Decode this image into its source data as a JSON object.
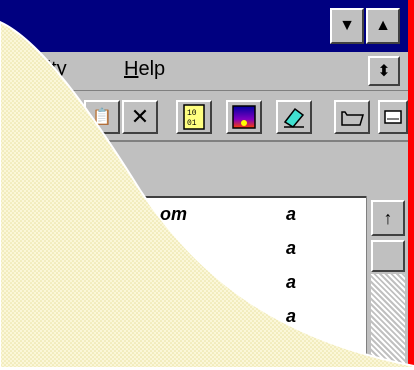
{
  "title_bar": {
    "minimize_glyph": "▼",
    "maximize_glyph": "▲"
  },
  "menu": {
    "security_label": "rity",
    "help_label_first": "H",
    "help_label_rest": "elp",
    "restore_glyph": "⬍"
  },
  "toolbar": {
    "paste_glyph": "📋",
    "delete_glyph": "✕",
    "binary_glyph": "10\n01",
    "image_glyph": "",
    "edit_glyph": "✎",
    "folder_glyph": "🗁",
    "drive_glyph": "▭"
  },
  "list": {
    "rows": [
      {
        "name": "om",
        "attr": "a"
      },
      {
        "name": "·",
        "attr": "a"
      },
      {
        "name": "",
        "attr": "a"
      },
      {
        "name": "",
        "attr": "a"
      }
    ]
  },
  "scrollbar": {
    "up_glyph": "↑"
  },
  "colors": {
    "titlebar": "#000080",
    "face": "#c0c0c0",
    "border_red": "#ff0000",
    "peel": "#f8f3c8"
  }
}
